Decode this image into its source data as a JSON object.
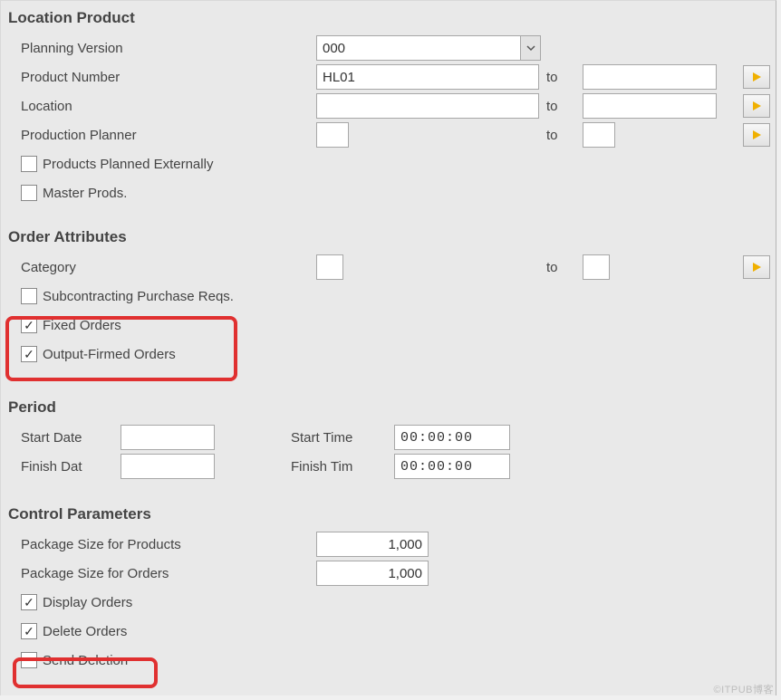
{
  "locationProduct": {
    "title": "Location Product",
    "planningVersion": {
      "label": "Planning Version",
      "value": "000"
    },
    "productNumber": {
      "label": "Product Number",
      "from": "HL01",
      "to": ""
    },
    "location": {
      "label": "Location",
      "from": "",
      "to": ""
    },
    "productionPlanner": {
      "label": "Production Planner",
      "from": "",
      "to": ""
    },
    "toLabel": "to",
    "productsExternal": {
      "label": "Products Planned Externally",
      "checked": false
    },
    "masterProds": {
      "label": "Master Prods.",
      "checked": false
    }
  },
  "orderAttributes": {
    "title": "Order Attributes",
    "category": {
      "label": "Category",
      "from": "",
      "to": ""
    },
    "toLabel": "to",
    "subcontracting": {
      "label": "Subcontracting Purchase Reqs.",
      "checked": false
    },
    "fixedOrders": {
      "label": "Fixed Orders",
      "checked": true
    },
    "outputFirmed": {
      "label": "Output-Firmed Orders",
      "checked": true
    }
  },
  "period": {
    "title": "Period",
    "startDate": {
      "label": "Start Date",
      "value": ""
    },
    "finishDate": {
      "label": "Finish Dat",
      "value": ""
    },
    "startTime": {
      "label": "Start Time",
      "value": "00:00:00"
    },
    "finishTime": {
      "label": "Finish Tim",
      "value": "00:00:00"
    }
  },
  "control": {
    "title": "Control Parameters",
    "pkgProducts": {
      "label": "Package Size for Products",
      "value": "1,000"
    },
    "pkgOrders": {
      "label": "Package Size for Orders",
      "value": "1,000"
    },
    "displayOrders": {
      "label": "Display Orders",
      "checked": true
    },
    "deleteOrders": {
      "label": "Delete Orders",
      "checked": true
    },
    "sendDeletion": {
      "label": "Send Deletion",
      "checked": false
    }
  },
  "watermark": "©ITPUB博客"
}
